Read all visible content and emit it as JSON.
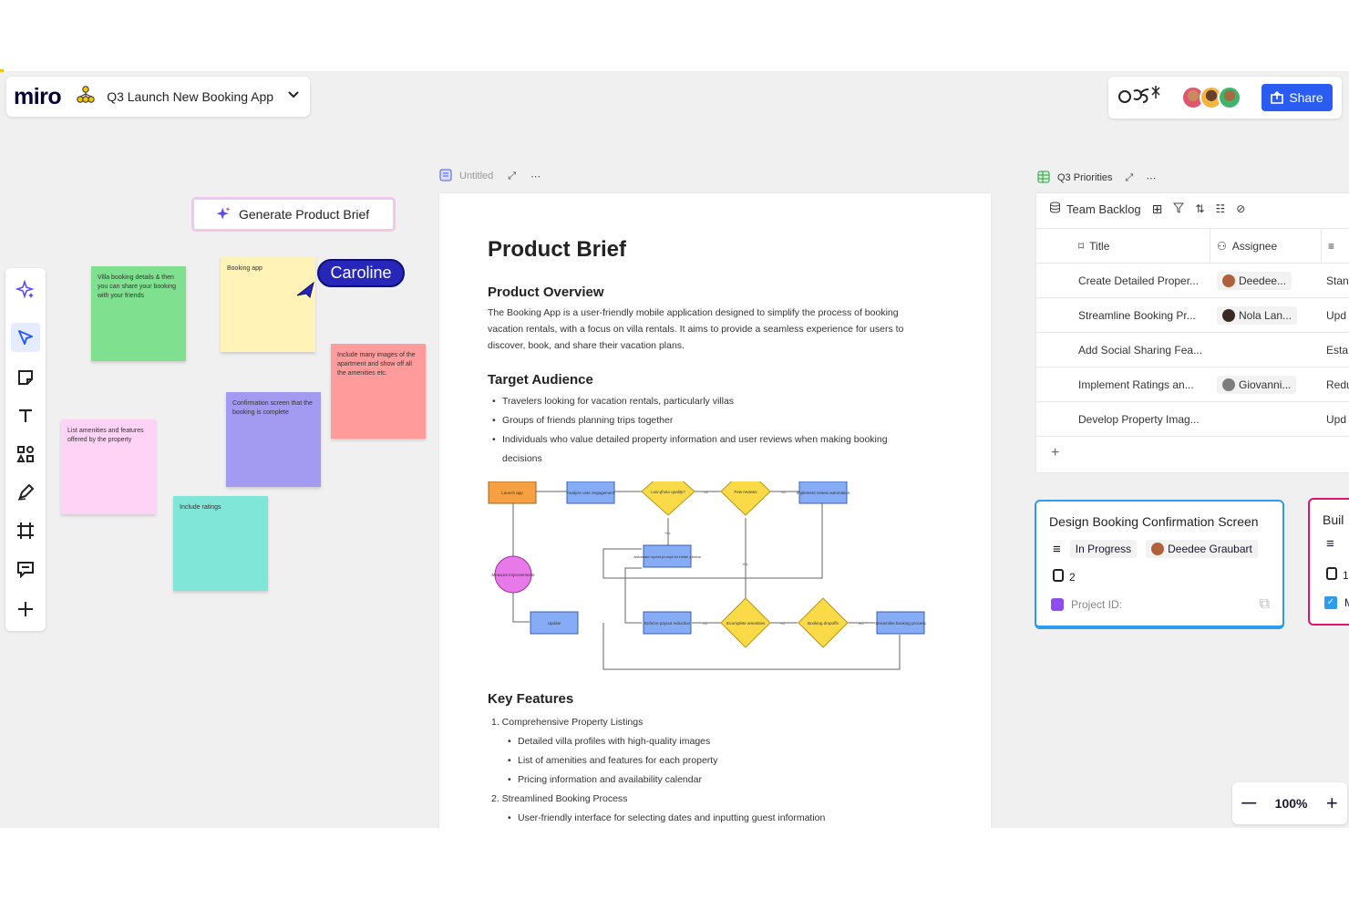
{
  "header": {
    "logo": "miro",
    "board_title": "Q3 Launch New Booking App",
    "share_label": "Share"
  },
  "toolbar": {
    "items": [
      "ai-sparkle-icon",
      "select-cursor-icon",
      "sticky-note-icon",
      "text-icon",
      "shapes-icon",
      "pen-icon",
      "frame-icon",
      "comment-icon",
      "add-icon"
    ]
  },
  "generate_button": "Generate Product Brief",
  "collaborator": "Caroline",
  "stickies": [
    {
      "text": "Villa booking details & then you can share your booking with your friends",
      "color": "#7fe08f"
    },
    {
      "text": "Booking app",
      "color": "#fff3b8"
    },
    {
      "text": "Include many images of the apartment and show off all the amenities etc.",
      "color": "#ff9b9b"
    },
    {
      "text": "Confirmation screen that the booking is complete",
      "color": "#a39af2"
    },
    {
      "text": "List amenities and features offered by the property",
      "color": "#ffd3f5"
    },
    {
      "text": "Include ratings",
      "color": "#7fe6d8"
    }
  ],
  "doc": {
    "tab_title": "Untitled",
    "title": "Product Brief",
    "overview_heading": "Product Overview",
    "overview_text": "The Booking App is a user-friendly mobile application designed to simplify the process of booking vacation rentals, with a focus on villa rentals. It aims to provide a seamless experience for users to discover, book, and share their vacation plans.",
    "audience_heading": "Target Audience",
    "audience": [
      "Travelers looking for vacation rentals, particularly villas",
      "Groups of friends planning trips together",
      "Individuals who value detailed property information and user reviews when making booking decisions"
    ],
    "features_heading": "Key Features",
    "features": [
      {
        "label": "1. Comprehensive Property Listings",
        "items": [
          "Detailed villa profiles with high-quality images",
          "List of amenities and features for each property",
          "Pricing information and availability calendar"
        ]
      },
      {
        "label": "2. Streamlined Booking Process",
        "items": [
          "User-friendly interface for selecting dates and inputting guest information"
        ]
      }
    ],
    "flow": {
      "launch": "Launch app",
      "analyze": "Analyze user engagement",
      "low_photo": "Low photo quality?",
      "few_reviews": "Few reviews",
      "implement_review": "Implement review automation",
      "automate_prompt": "Automate repeat prompt for better photos",
      "measure": "Measure improvements",
      "update": "Update",
      "enforce": "Enforce payout reduction",
      "incomplete": "Incomplete amenities",
      "booking_dropoffs": "Booking dropoffs",
      "streamline": "Streamline booking process",
      "yes": "Yes",
      "no": "No"
    }
  },
  "priorities": {
    "tab_title": "Q3 Priorities",
    "view_name": "Team Backlog",
    "columns": [
      "Title",
      "Assignee"
    ],
    "rows": [
      {
        "title": "Create Detailed Proper...",
        "assignee": "Deedee...",
        "status": "Stan"
      },
      {
        "title": "Streamline Booking Pr...",
        "assignee": "Nola Lan...",
        "status": "Upd"
      },
      {
        "title": "Add Social Sharing Fea...",
        "assignee": "",
        "status": "Esta"
      },
      {
        "title": "Implement Ratings an...",
        "assignee": "Giovanni...",
        "status": "Redu"
      },
      {
        "title": "Develop Property Imag...",
        "assignee": "",
        "status": "Upd"
      }
    ],
    "add_label": "+"
  },
  "card": {
    "title": "Design Booking Confirmation Screen",
    "status": "In Progress",
    "assignee": "Deedee Graubart",
    "count": "2",
    "project_label": "Project ID:"
  },
  "card2": {
    "title": "Buil",
    "count": "1",
    "check_label": "M"
  },
  "zoom": {
    "level": "100%",
    "minus": "—",
    "plus": "+"
  },
  "colors": {
    "accent": "#2b5cf2",
    "card_border": "#2d9bf0",
    "card2_border": "#e0126e",
    "collaborator": "#2626b8"
  }
}
